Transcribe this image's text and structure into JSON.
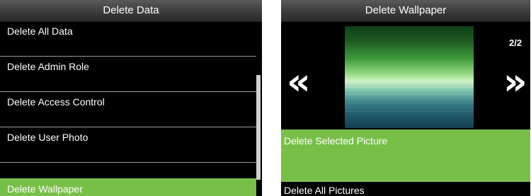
{
  "left_screen": {
    "title": "Delete Data",
    "items": [
      {
        "label": "Delete All Data"
      },
      {
        "label": "Delete Admin Role"
      },
      {
        "label": "Delete Access Control"
      },
      {
        "label": "Delete User Photo"
      },
      {
        "label": "Delete Wallpaper",
        "selected": true
      }
    ]
  },
  "right_screen": {
    "title": "Delete Wallpaper",
    "prev_arrow": "«",
    "next_arrow": "»",
    "counter": "2/2",
    "items": [
      {
        "label": "Delete Selected Picture",
        "selected": true
      },
      {
        "label": "Delete All Pictures"
      }
    ]
  },
  "colors": {
    "selected": "#78bf48",
    "background": "#000000",
    "text": "#ffffff"
  },
  "icons": {
    "prev": "double-chevron-left-icon",
    "next": "double-chevron-right-icon"
  }
}
